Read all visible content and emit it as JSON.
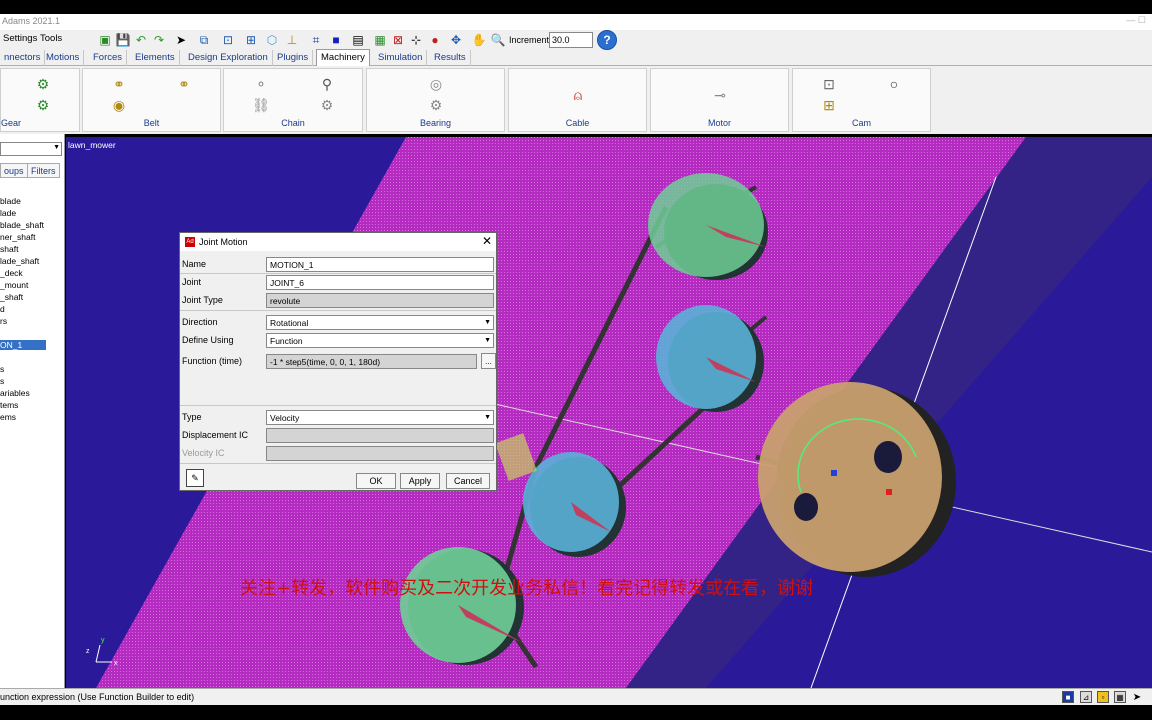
{
  "window": {
    "title": "Adams 2021.1",
    "controls": "— ☐"
  },
  "menu": {
    "settings": "Settings",
    "tools": "Tools"
  },
  "toolbar": {
    "increment_label": "Increment",
    "increment_value": "30.0"
  },
  "tabs": [
    "nnectors",
    "Motions",
    "Forces",
    "Elements",
    "Design Exploration",
    "Plugins",
    "Machinery",
    "Simulation",
    "Results"
  ],
  "active_tab": "Machinery",
  "ribbon": {
    "groups": [
      {
        "label": "Gear"
      },
      {
        "label": "Belt"
      },
      {
        "label": "Chain"
      },
      {
        "label": "Bearing"
      },
      {
        "label": "Cable"
      },
      {
        "label": "Motor"
      },
      {
        "label": "Cam"
      }
    ]
  },
  "left_panel": {
    "tabs": [
      "oups",
      "Filters"
    ],
    "tree_items": [
      "blade",
      "lade",
      "blade_shaft",
      "ner_shaft",
      "shaft",
      "lade_shaft",
      "_deck",
      "_mount",
      "_shaft",
      "d",
      "rs",
      "ON_1",
      "s",
      "s",
      "ariables",
      "tems",
      "ems"
    ],
    "selected": "ON_1"
  },
  "viewport": {
    "model_name": "lawn_mower",
    "triad": {
      "y": "y",
      "z": "z",
      "x": "x"
    }
  },
  "watermark": "关注+转发，软件购买及二次开发业务私信！看完记得转发或在看，谢谢",
  "dialog": {
    "title": "Joint Motion",
    "icon": "Ad",
    "fields": {
      "name_label": "Name",
      "name_value": "MOTION_1",
      "joint_label": "Joint",
      "joint_value": "JOINT_6",
      "joint_type_label": "Joint Type",
      "joint_type_value": "revolute",
      "direction_label": "Direction",
      "direction_value": "Rotational",
      "define_using_label": "Define Using",
      "define_using_value": "Function",
      "function_label": "Function (time)",
      "function_value": "-1 * step5(time, 0, 0, 1, 180d)",
      "function_btn": "...",
      "type_label": "Type",
      "type_value": "Velocity",
      "disp_ic_label": "Displacement IC",
      "disp_ic_value": "",
      "vel_ic_label": "Velocity IC",
      "vel_ic_value": ""
    },
    "buttons": {
      "ok": "OK",
      "apply": "Apply",
      "cancel": "Cancel"
    }
  },
  "status": {
    "text": "unction expression (Use Function Builder to edit)"
  },
  "colors": {
    "viewport_bg": "#2a1a9a",
    "plate": "#b02ab8",
    "pulley_green": "#6fcf97",
    "pulley_blue": "#5aa8d8",
    "big_pulley": "#c9a070",
    "selection": "#3470c6"
  }
}
